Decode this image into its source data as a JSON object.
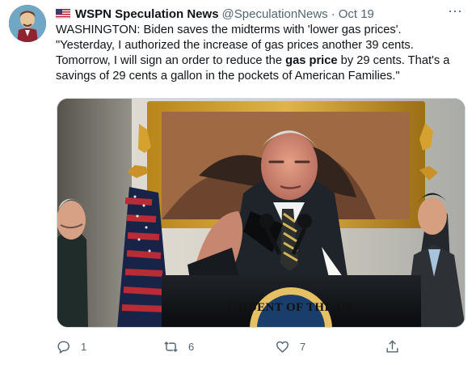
{
  "tweet": {
    "author_name": "WSPN Speculation News",
    "handle": "@SpeculationNews",
    "separator": "·",
    "date": "Oct 19",
    "more_label": "···",
    "lines": [
      "WASHINGTON: Biden saves the midterms with 'lower gas prices'.",
      "\"Yesterday, I authorized the increase of gas prices another 39 cents.",
      "savings of 29 cents a gallon in the pockets of American Families.\""
    ],
    "line3_before": "Tomorrow, I will sign an order to reduce the ",
    "line3_bold": "gas price",
    "line3_after": " by 29 cents. That's a",
    "seal_text": "ESIDENT OF THE UN",
    "reply_count": "1",
    "retweet_count": "6",
    "like_count": "7"
  },
  "colors": {
    "text": "#0f1419",
    "secondary": "#536471",
    "border": "#cfd9de"
  },
  "icons": {
    "flag": "us-flag-icon",
    "more": "more-horizontal-icon",
    "reply": "reply-icon",
    "retweet": "retweet-icon",
    "like": "heart-icon",
    "share": "share-icon"
  }
}
